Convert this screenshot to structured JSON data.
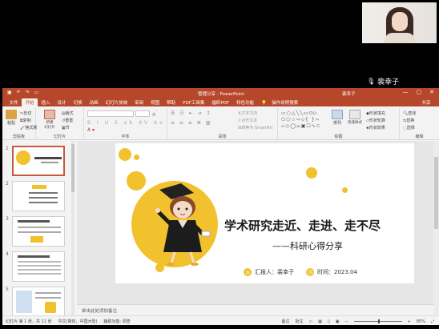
{
  "meeting": {
    "speaker_name": "裴幸子"
  },
  "titlebar": {
    "doc_title": "管理分享 - PowerPoint",
    "user": "裴幸子"
  },
  "menu": {
    "tabs": [
      "文件",
      "开始",
      "插入",
      "设计",
      "切换",
      "动画",
      "幻灯片放映",
      "审阅",
      "视图",
      "帮助",
      "PDF工具集",
      "福昕PDF",
      "特色功能",
      "操作说明搜索"
    ],
    "active_index": 1,
    "share": "共享"
  },
  "ribbon": {
    "clipboard": {
      "paste": "粘贴",
      "cut": "剪切",
      "copy": "复制",
      "format_painter": "格式刷",
      "label": "剪贴板"
    },
    "slides": {
      "new_slide": "新建\n幻灯片",
      "layout": "版式",
      "reset": "重置",
      "section": "节",
      "label": "幻灯片"
    },
    "font": {
      "label": "字体"
    },
    "paragraph": {
      "text_direction": "文字方向",
      "align_text": "对齐文本",
      "smartart": "转换为 SmartArt",
      "label": "段落"
    },
    "drawing": {
      "arrange": "排列",
      "quick_styles": "快速样式",
      "fill": "形状填充",
      "outline": "形状轮廓",
      "effects": "形状效果",
      "label": "绘图"
    },
    "editing": {
      "find": "查找",
      "replace": "替换",
      "select": "选择",
      "label": "编辑"
    }
  },
  "thumbnails": {
    "numbers": [
      "1",
      "2",
      "3",
      "4",
      "5"
    ],
    "selected_index": 0
  },
  "slide": {
    "title": "学术研究走近、走进、走不尽",
    "subtitle": "——科研心得分享",
    "reporter": "汇报人：裴幸子",
    "time": "时间：2023.04",
    "accent_color": "#f2c12e"
  },
  "notes": {
    "placeholder": "单击此处添加备注"
  },
  "statusbar": {
    "slide_info": "幻灯片 第 1 张，共 11 张",
    "language": "中文(简体，中国大陆)",
    "accessibility": "辅助功能: 调查",
    "notes": "备注",
    "comments": "批注",
    "zoom": "85%"
  }
}
